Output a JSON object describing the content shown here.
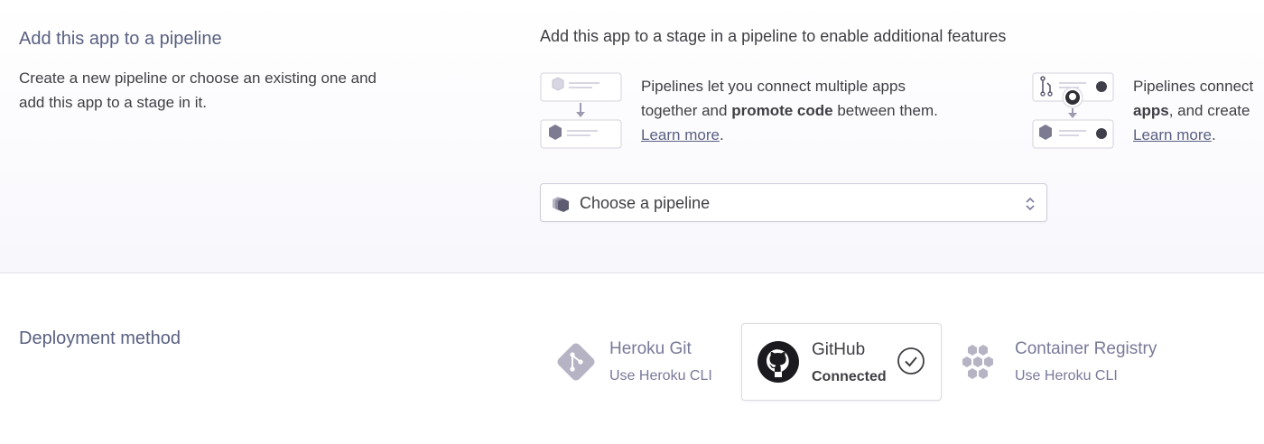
{
  "pipeline": {
    "title": "Add this app to a pipeline",
    "description": "Create a new pipeline or choose an existing one and add this app to a stage in it.",
    "heading": "Add this app to a stage in a pipeline to enable additional features",
    "features": [
      {
        "icon": "pipeline-stages-illustration-icon",
        "line1": "Pipelines let you connect multiple apps",
        "line2_pre": "together and ",
        "line2_bold": "promote code",
        "line2_post": " between them.",
        "link": "Learn more",
        "link_after": "."
      },
      {
        "icon": "github-pipeline-illustration-icon",
        "line1": "Pipelines connect",
        "line2_bold": "apps",
        "line2_post": ", and create",
        "link": "Learn more",
        "link_after": "."
      }
    ],
    "select": {
      "icon": "pipeline-icon",
      "label": "Choose a pipeline",
      "chevron_icon": "up-down-chevron-icon"
    }
  },
  "deployment": {
    "title": "Deployment method",
    "methods": [
      {
        "icon": "heroku-git-icon",
        "title": "Heroku Git",
        "subtitle": "Use Heroku CLI",
        "selected": false
      },
      {
        "icon": "github-icon",
        "title": "GitHub",
        "subtitle": "Connected",
        "selected": true,
        "status_icon": "check-circle-icon"
      },
      {
        "icon": "container-registry-icon",
        "title": "Container Registry",
        "subtitle": "Use Heroku CLI",
        "selected": false
      }
    ]
  },
  "colors": {
    "accent": "#596081",
    "text": "#3f3f44",
    "muted": "#79799a",
    "border": "#dcdae3"
  }
}
